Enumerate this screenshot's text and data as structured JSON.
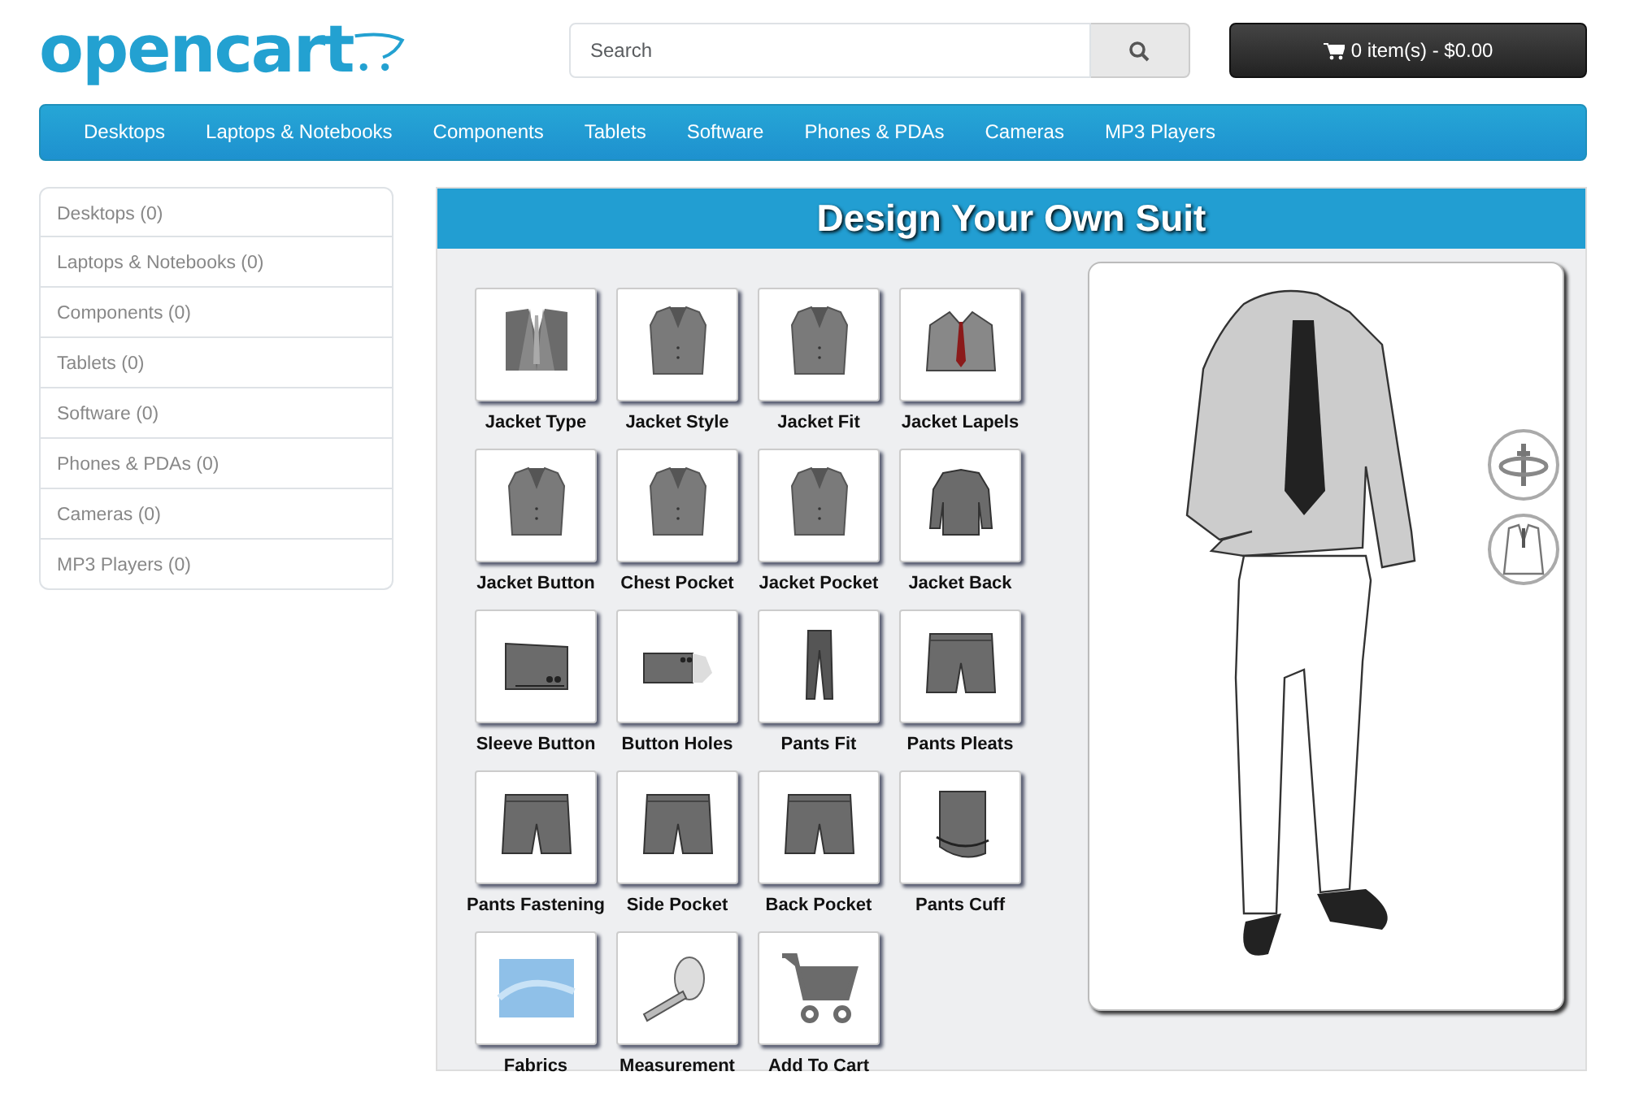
{
  "header": {
    "logo": "opencart",
    "search": {
      "placeholder": "Search"
    },
    "cart_button": "0 item(s) - $0.00"
  },
  "menu": [
    "Desktops",
    "Laptops & Notebooks",
    "Components",
    "Tablets",
    "Software",
    "Phones & PDAs",
    "Cameras",
    "MP3 Players"
  ],
  "sidebar": {
    "items": [
      "Desktops (0)",
      "Laptops & Notebooks (0)",
      "Components (0)",
      "Tablets (0)",
      "Software (0)",
      "Phones & PDAs (0)",
      "Cameras (0)",
      "MP3 Players (0)"
    ]
  },
  "designer": {
    "title": "Design Your Own Suit",
    "options": [
      {
        "label": "Jacket Type",
        "kind": "vest"
      },
      {
        "label": "Jacket Style",
        "kind": "jacket"
      },
      {
        "label": "Jacket Fit",
        "kind": "jacket"
      },
      {
        "label": "Jacket Lapels",
        "kind": "lapels"
      },
      {
        "label": "Jacket Button",
        "kind": "jacket"
      },
      {
        "label": "Chest Pocket",
        "kind": "jacket"
      },
      {
        "label": "Jacket Pocket",
        "kind": "jacket"
      },
      {
        "label": "Jacket Back",
        "kind": "back"
      },
      {
        "label": "Sleeve Button",
        "kind": "sleeve"
      },
      {
        "label": "Button Holes",
        "kind": "cuffholes"
      },
      {
        "label": "Pants Fit",
        "kind": "trousers"
      },
      {
        "label": "Pants Pleats",
        "kind": "shorts"
      },
      {
        "label": "Pants Fastening",
        "kind": "shorts"
      },
      {
        "label": "Side Pocket",
        "kind": "shorts"
      },
      {
        "label": "Back Pocket",
        "kind": "shorts"
      },
      {
        "label": "Pants Cuff",
        "kind": "cuff"
      },
      {
        "label": "Fabrics",
        "kind": "fabric"
      },
      {
        "label": "Measurement",
        "kind": "tape"
      },
      {
        "label": "Add To Cart",
        "kind": "cart"
      }
    ]
  }
}
